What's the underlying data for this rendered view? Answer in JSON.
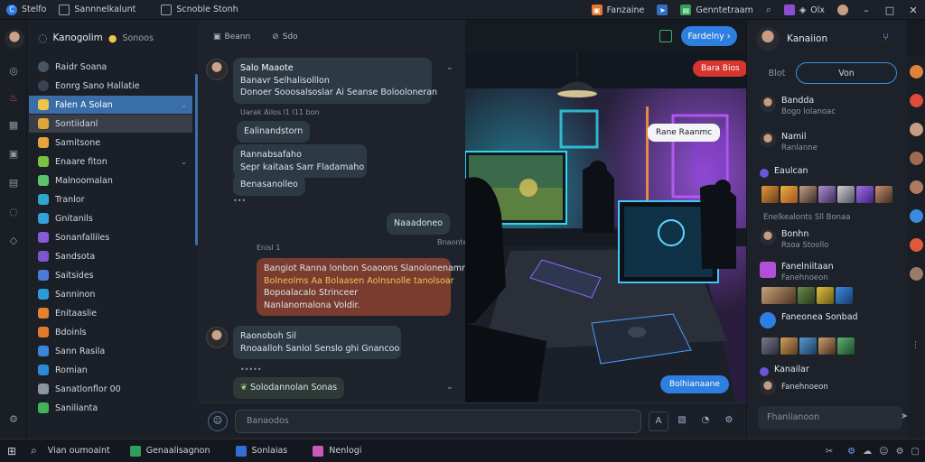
{
  "topbar": {
    "app_name": "Stelfo",
    "tabs": [
      "Sannnelkalunt",
      "Scnoble Stonh"
    ],
    "right_tabs": [
      "Fanzaine",
      "Genntetraam"
    ],
    "right_text": "Olx"
  },
  "rail": {
    "icons": [
      "compass-icon",
      "flame-icon",
      "grid-icon",
      "calendar-icon",
      "document-icon",
      "chat-icon",
      "tag-icon",
      "settings-icon"
    ]
  },
  "sidebar": {
    "title": "Kanogolim",
    "status": "Sonoos",
    "channels": [
      {
        "label": "Raidr Soana",
        "color": "#4a5563"
      },
      {
        "label": "Eonrg Sano Hallatie",
        "color": "#3b4350"
      },
      {
        "label": "Falen A Solan",
        "color": "#f0c44a"
      },
      {
        "label": "Sontiidanl",
        "color": "#e0a53a"
      },
      {
        "label": "Samitsone",
        "color": "#e6a23c"
      },
      {
        "label": "Enaare fiton",
        "color": "#79c043"
      },
      {
        "label": "Malnoomalan",
        "color": "#5bc46a"
      },
      {
        "label": "Tranlor",
        "color": "#2ea7c9"
      },
      {
        "label": "Gnitanils",
        "color": "#35a0d8"
      },
      {
        "label": "Sonanfalliles",
        "color": "#8a5ad6"
      },
      {
        "label": "Sandsota",
        "color": "#7b56d0"
      },
      {
        "label": "Saitsides",
        "color": "#4b7ad8"
      },
      {
        "label": "Sanninon",
        "color": "#2f9ad6"
      },
      {
        "label": "Enitaaslie",
        "color": "#e0822e"
      },
      {
        "label": "Bdoinls",
        "color": "#e07a2d"
      },
      {
        "label": "Sann Rasila",
        "color": "#3a86d9"
      },
      {
        "label": "Romian",
        "color": "#2d8ad6"
      },
      {
        "label": "Sanatlonflor 00",
        "color": "#8b96a3"
      },
      {
        "label": "Sanilianta",
        "color": "#42b35c"
      }
    ]
  },
  "chat": {
    "header_buttons": [
      "Beann",
      "Sdo"
    ],
    "action_button": "Fardelny",
    "messages": [
      {
        "lines": [
          "Salo Maaote",
          "Banavr Selhalisolllon",
          "Donoer Sooosalsoslar Ai Seanse Bolooloneran"
        ],
        "align": "left"
      },
      {
        "lines": [
          "Ealinandstorn"
        ],
        "align": "left"
      },
      {
        "lines": [
          "Rannabsafaho",
          "Sepr kaitaas Sarr Fladamaho",
          "Benasanolleo"
        ],
        "align": "left"
      },
      {
        "lines": [
          "Naaadoneo"
        ],
        "align": "right"
      },
      {
        "lines": [
          "Bangiot Ranna lonbon Soaoons Slanolonenamno",
          "Bolneolms Aa Bolaasen Aolnsnolle tanolsoar",
          "Bopoalacalo Strinceer",
          "Nanlanomalona Voldir."
        ],
        "align": "right"
      },
      {
        "lines": [
          "Raonoboh Sil",
          "Rnoaalloh Sanlol Senslo ghi Gnancoo"
        ],
        "align": "left"
      },
      {
        "lines": [
          "Solodannolan Sonas"
        ],
        "align": "left"
      }
    ],
    "meta": [
      "Uarak Ailos l1 l11 bon",
      "Enisl 1",
      "Bnaonte"
    ],
    "composer_placeholder": "Banaodos"
  },
  "photo": {
    "badge": "Bara Bios",
    "bubble": "Rane Raanmc",
    "action": "Bolhianaane"
  },
  "rpanel": {
    "title": "Kanaiion",
    "tabs": [
      "Blot",
      "Von"
    ],
    "users": [
      {
        "name": "Bandda",
        "sub": "Bogo lolanoac"
      },
      {
        "name": "Namil",
        "sub": "Ranlanne"
      },
      {
        "name": "Eaulcan",
        "sub": "Enelkealonts Sll Bonaa"
      },
      {
        "name": "Bonhn",
        "sub": "Rsoa Stoollo"
      },
      {
        "name": "Fanelniitaan",
        "sub": "Fanehnoeon"
      },
      {
        "name": "Kanailar",
        "sub": "Faneonea Sonbad"
      }
    ],
    "input_placeholder": "Fhanlianoon"
  },
  "taskbar": {
    "search": "Vian oumoaint",
    "apps": [
      "Genaalisagnon",
      "Sonlaias",
      "Nenlogi"
    ]
  }
}
